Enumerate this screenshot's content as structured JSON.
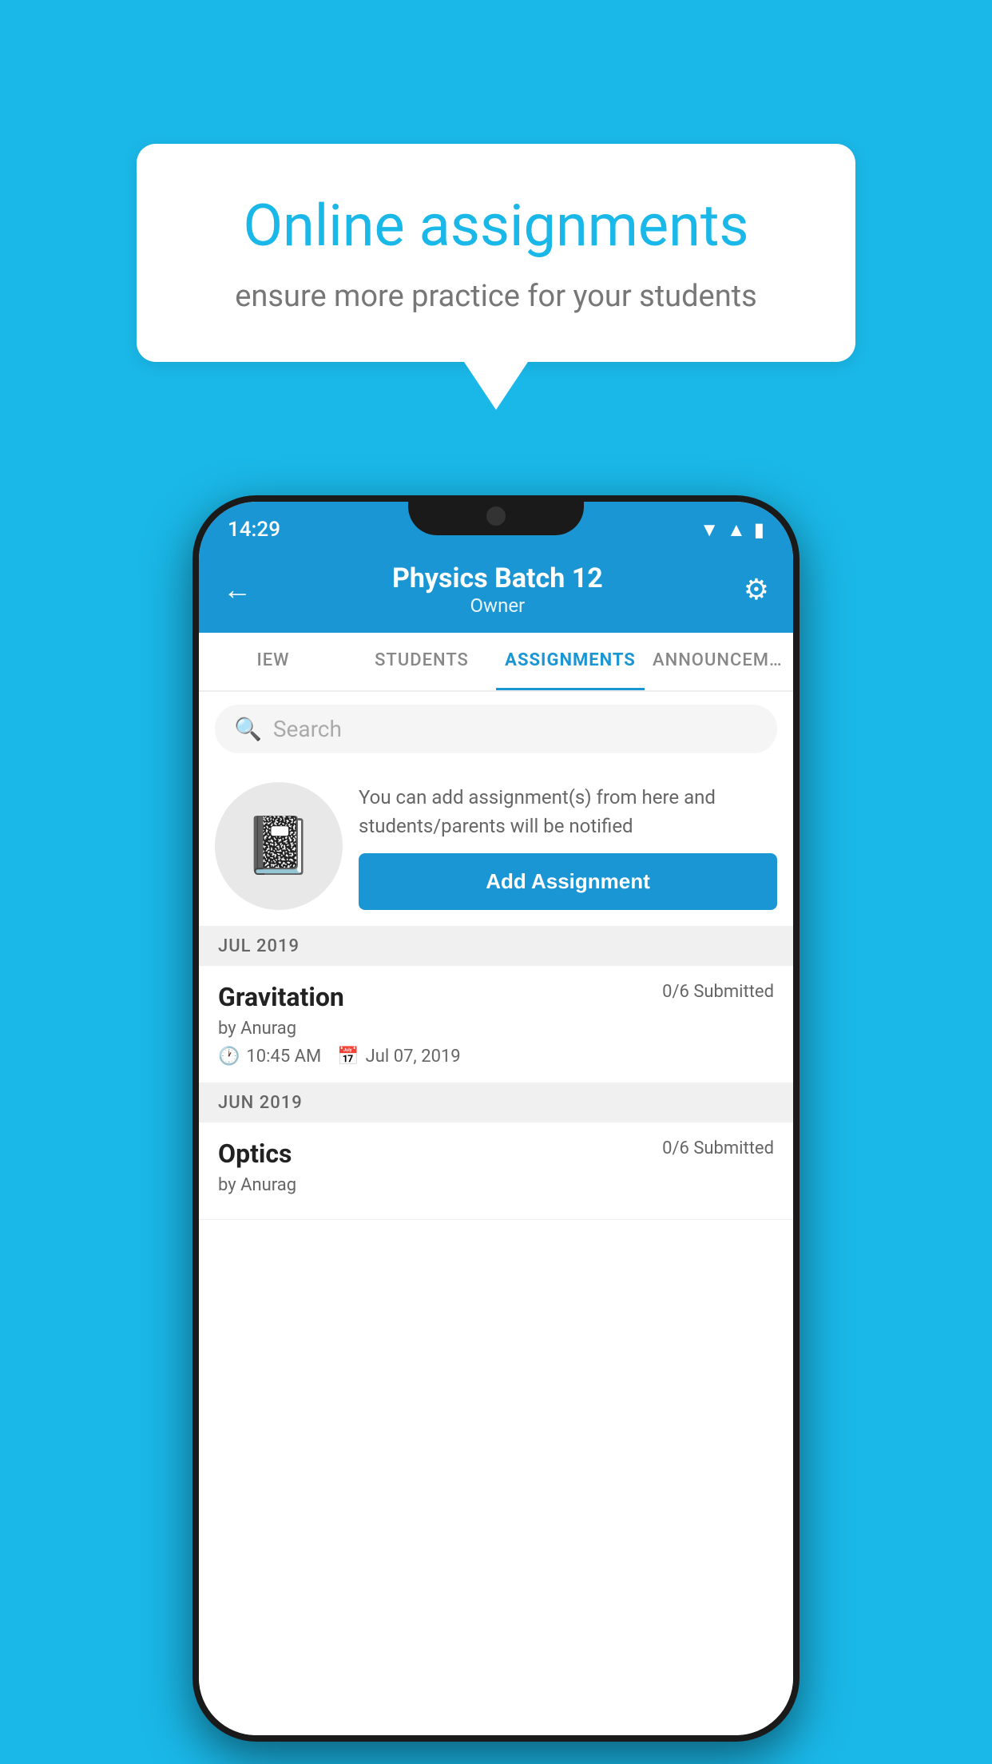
{
  "background_color": "#1ab8e8",
  "speech_bubble": {
    "title": "Online assignments",
    "subtitle": "ensure more practice for your students"
  },
  "phone": {
    "status_bar": {
      "time": "14:29",
      "icons": [
        "wifi",
        "signal",
        "battery"
      ]
    },
    "header": {
      "title": "Physics Batch 12",
      "subtitle": "Owner",
      "back_label": "←",
      "gear_label": "⚙"
    },
    "tabs": [
      {
        "label": "IEW",
        "active": false
      },
      {
        "label": "STUDENTS",
        "active": false
      },
      {
        "label": "ASSIGNMENTS",
        "active": true
      },
      {
        "label": "ANNOUNCEMENTS",
        "active": false
      }
    ],
    "search": {
      "placeholder": "Search"
    },
    "promo": {
      "icon": "📓",
      "text": "You can add assignment(s) from here and students/parents will be notified",
      "button_label": "Add Assignment"
    },
    "month_sections": [
      {
        "month": "JUL 2019",
        "assignments": [
          {
            "name": "Gravitation",
            "submitted": "0/6 Submitted",
            "by": "by Anurag",
            "time": "10:45 AM",
            "date": "Jul 07, 2019"
          }
        ]
      },
      {
        "month": "JUN 2019",
        "assignments": [
          {
            "name": "Optics",
            "submitted": "0/6 Submitted",
            "by": "by Anurag",
            "time": "",
            "date": ""
          }
        ]
      }
    ]
  }
}
